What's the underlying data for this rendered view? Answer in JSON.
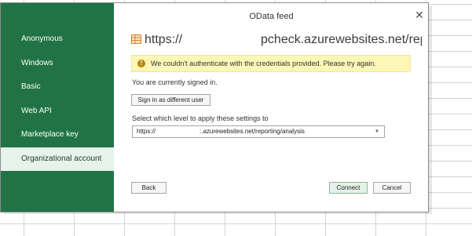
{
  "dialog": {
    "title": "OData feed",
    "url_prefix": "https://",
    "url_suffix": "pcheck.azurewebsites.net/reporting..."
  },
  "sidebar": {
    "items": [
      {
        "label": "Anonymous"
      },
      {
        "label": "Windows"
      },
      {
        "label": "Basic"
      },
      {
        "label": "Web API"
      },
      {
        "label": "Marketplace key"
      },
      {
        "label": "Organizational account",
        "selected": true
      }
    ]
  },
  "warning": {
    "text": "We couldn't authenticate with the credentials provided. Please try again."
  },
  "signin": {
    "status": "You are currently signed in.",
    "button_label": "Sign in as different user"
  },
  "level": {
    "label": "Select which level to apply these settings to",
    "value_prefix": "https://",
    "value_suffix": ":.azurewebsites.net/reporting/analysis"
  },
  "buttons": {
    "back": "Back",
    "connect": "Connect",
    "cancel": "Cancel"
  },
  "colors": {
    "sidebar": "#217346",
    "warning_bg": "#fcf7b6"
  }
}
